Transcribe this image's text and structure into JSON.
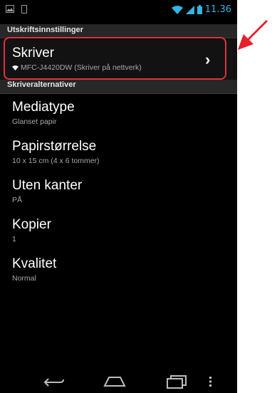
{
  "status": {
    "time": "11.36"
  },
  "sections": {
    "print_settings": "Utskriftsinnstillinger",
    "printer_options": "Skriveralternativer"
  },
  "printer": {
    "title": "Skriver",
    "subtitle": "MFC-J4420DW (Skriver på nettverk)"
  },
  "options": [
    {
      "title": "Mediatype",
      "value": "Glanset papir"
    },
    {
      "title": "Papirstørrelse",
      "value": "10 x 15 cm (4 x 6 tommer)"
    },
    {
      "title": "Uten kanter",
      "value": "PÅ"
    },
    {
      "title": "Kopier",
      "value": "1"
    },
    {
      "title": "Kvalitet",
      "value": "Normal"
    }
  ],
  "colors": {
    "accent": "#33b5e5",
    "highlight": "#e03040",
    "arrow": "#e8202a"
  },
  "icons": [
    "image-icon",
    "phone-icon",
    "wifi-icon",
    "signal-icon",
    "battery-icon",
    "chevron-right-icon",
    "back-icon",
    "home-icon",
    "recent-apps-icon",
    "overflow-menu-icon",
    "red-arrow-icon"
  ]
}
